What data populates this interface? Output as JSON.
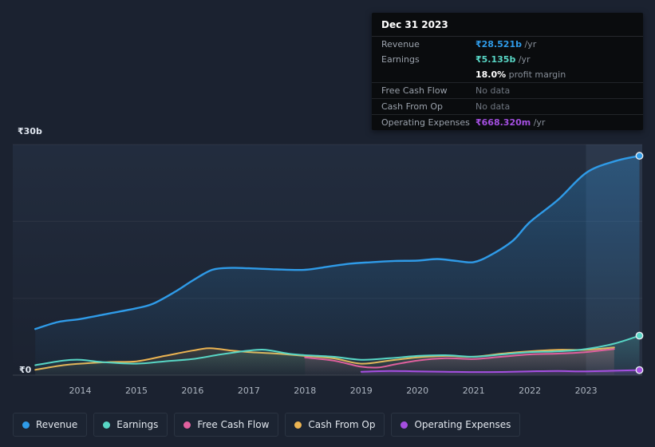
{
  "colors": {
    "background": "#1b2230",
    "revenue": "#2f9be8",
    "earnings": "#58d6c5",
    "free_cash_flow": "#e0609e",
    "cash_from_op": "#ecb452",
    "operating_expenses": "#a44fe0",
    "axis_text": "#aeb6c1",
    "muted_text": "#6f7680"
  },
  "tooltip": {
    "date": "Dec 31 2023",
    "rows": [
      {
        "label": "Revenue",
        "value": "₹28.521b",
        "suffix": " /yr",
        "color": "#2f9be8"
      },
      {
        "label": "Earnings",
        "value": "₹5.135b",
        "suffix": " /yr",
        "color": "#58d6c5"
      },
      {
        "label": "",
        "value": "18.0%",
        "suffix": " profit margin",
        "color": "#ffffff"
      },
      {
        "label": "Free Cash Flow",
        "value": "No data",
        "suffix": "",
        "color": "#6f7680"
      },
      {
        "label": "Cash From Op",
        "value": "No data",
        "suffix": "",
        "color": "#6f7680"
      },
      {
        "label": "Operating Expenses",
        "value": "₹668.320m",
        "suffix": " /yr",
        "color": "#a44fe0"
      }
    ]
  },
  "chart_data": {
    "type": "area",
    "title": "Earnings and Revenue History",
    "x_range": [
      2012.8,
      2024.0
    ],
    "y_range": [
      0,
      30
    ],
    "x_ticks": [
      2014,
      2015,
      2016,
      2017,
      2018,
      2019,
      2020,
      2021,
      2022,
      2023
    ],
    "gridline_values": [
      0,
      10,
      20,
      30
    ],
    "y_axis": {
      "top_label": "₹30b",
      "zero_label": "₹0",
      "unit": "billions INR"
    },
    "highlight_from": 2023.0,
    "legend_position": "bottom",
    "series": [
      {
        "id": "revenue",
        "name": "Revenue",
        "color": "#2f9be8",
        "width": 2.4,
        "fill_opacity": 0.3,
        "end_dot": true,
        "points": [
          [
            2013.2,
            6.0
          ],
          [
            2013.6,
            6.9
          ],
          [
            2014,
            7.3
          ],
          [
            2014.5,
            8.0
          ],
          [
            2015,
            8.7
          ],
          [
            2015.3,
            9.3
          ],
          [
            2015.7,
            10.9
          ],
          [
            2016,
            12.3
          ],
          [
            2016.35,
            13.7
          ],
          [
            2016.7,
            13.95
          ],
          [
            2017,
            13.9
          ],
          [
            2017.5,
            13.75
          ],
          [
            2018,
            13.7
          ],
          [
            2018.4,
            14.1
          ],
          [
            2018.8,
            14.5
          ],
          [
            2019.2,
            14.7
          ],
          [
            2019.6,
            14.85
          ],
          [
            2020,
            14.9
          ],
          [
            2020.35,
            15.1
          ],
          [
            2020.7,
            14.85
          ],
          [
            2021,
            14.7
          ],
          [
            2021.3,
            15.6
          ],
          [
            2021.7,
            17.5
          ],
          [
            2022,
            19.9
          ],
          [
            2022.5,
            22.8
          ],
          [
            2023,
            26.3
          ],
          [
            2023.5,
            27.8
          ],
          [
            2023.95,
            28.521
          ]
        ]
      },
      {
        "id": "earnings",
        "name": "Earnings",
        "color": "#58d6c5",
        "width": 2,
        "fill_opacity": 0.2,
        "end_dot": true,
        "points": [
          [
            2013.2,
            1.3
          ],
          [
            2013.7,
            1.9
          ],
          [
            2014,
            2.0
          ],
          [
            2014.4,
            1.7
          ],
          [
            2015,
            1.5
          ],
          [
            2015.5,
            1.8
          ],
          [
            2016,
            2.1
          ],
          [
            2016.5,
            2.7
          ],
          [
            2017,
            3.2
          ],
          [
            2017.3,
            3.3
          ],
          [
            2017.7,
            2.8
          ],
          [
            2018,
            2.6
          ],
          [
            2018.5,
            2.4
          ],
          [
            2019,
            2.0
          ],
          [
            2019.5,
            2.2
          ],
          [
            2020,
            2.5
          ],
          [
            2020.5,
            2.6
          ],
          [
            2021,
            2.4
          ],
          [
            2021.5,
            2.7
          ],
          [
            2022,
            3.0
          ],
          [
            2022.5,
            3.1
          ],
          [
            2023,
            3.4
          ],
          [
            2023.5,
            4.1
          ],
          [
            2023.95,
            5.135
          ]
        ]
      },
      {
        "id": "free-cash-flow",
        "name": "Free Cash Flow",
        "color": "#e0609e",
        "width": 2,
        "fill_opacity": 0.16,
        "end_dot": false,
        "points": [
          [
            2018,
            2.3
          ],
          [
            2018.5,
            1.9
          ],
          [
            2019,
            1.1
          ],
          [
            2019.3,
            1.0
          ],
          [
            2019.6,
            1.4
          ],
          [
            2020,
            1.9
          ],
          [
            2020.5,
            2.2
          ],
          [
            2021,
            2.1
          ],
          [
            2021.5,
            2.4
          ],
          [
            2022,
            2.7
          ],
          [
            2022.5,
            2.8
          ],
          [
            2023,
            3.0
          ],
          [
            2023.5,
            3.4
          ]
        ]
      },
      {
        "id": "cash-from-op",
        "name": "Cash From Op",
        "color": "#ecb452",
        "width": 2,
        "fill_opacity": 0.14,
        "end_dot": false,
        "points": [
          [
            2013.2,
            0.7
          ],
          [
            2013.7,
            1.3
          ],
          [
            2014,
            1.5
          ],
          [
            2014.5,
            1.7
          ],
          [
            2015,
            1.8
          ],
          [
            2015.5,
            2.5
          ],
          [
            2016,
            3.2
          ],
          [
            2016.3,
            3.5
          ],
          [
            2016.7,
            3.2
          ],
          [
            2017,
            3.0
          ],
          [
            2017.5,
            2.8
          ],
          [
            2018,
            2.5
          ],
          [
            2018.5,
            2.2
          ],
          [
            2019,
            1.5
          ],
          [
            2019.5,
            1.9
          ],
          [
            2020,
            2.3
          ],
          [
            2020.5,
            2.5
          ],
          [
            2021,
            2.4
          ],
          [
            2021.5,
            2.8
          ],
          [
            2022,
            3.1
          ],
          [
            2022.5,
            3.3
          ],
          [
            2023,
            3.3
          ],
          [
            2023.5,
            3.6
          ]
        ]
      },
      {
        "id": "operating-expenses",
        "name": "Operating Expenses",
        "color": "#a44fe0",
        "width": 2,
        "fill_opacity": 0.35,
        "end_dot": true,
        "points": [
          [
            2019,
            0.45
          ],
          [
            2019.5,
            0.55
          ],
          [
            2020,
            0.5
          ],
          [
            2020.5,
            0.45
          ],
          [
            2021,
            0.4
          ],
          [
            2021.5,
            0.42
          ],
          [
            2022,
            0.5
          ],
          [
            2022.5,
            0.55
          ],
          [
            2023,
            0.5
          ],
          [
            2023.95,
            0.668
          ]
        ]
      }
    ]
  },
  "legend": {
    "items": [
      {
        "label": "Revenue",
        "color": "#2f9be8"
      },
      {
        "label": "Earnings",
        "color": "#58d6c5"
      },
      {
        "label": "Free Cash Flow",
        "color": "#e0609e"
      },
      {
        "label": "Cash From Op",
        "color": "#ecb452"
      },
      {
        "label": "Operating Expenses",
        "color": "#a44fe0"
      }
    ]
  }
}
